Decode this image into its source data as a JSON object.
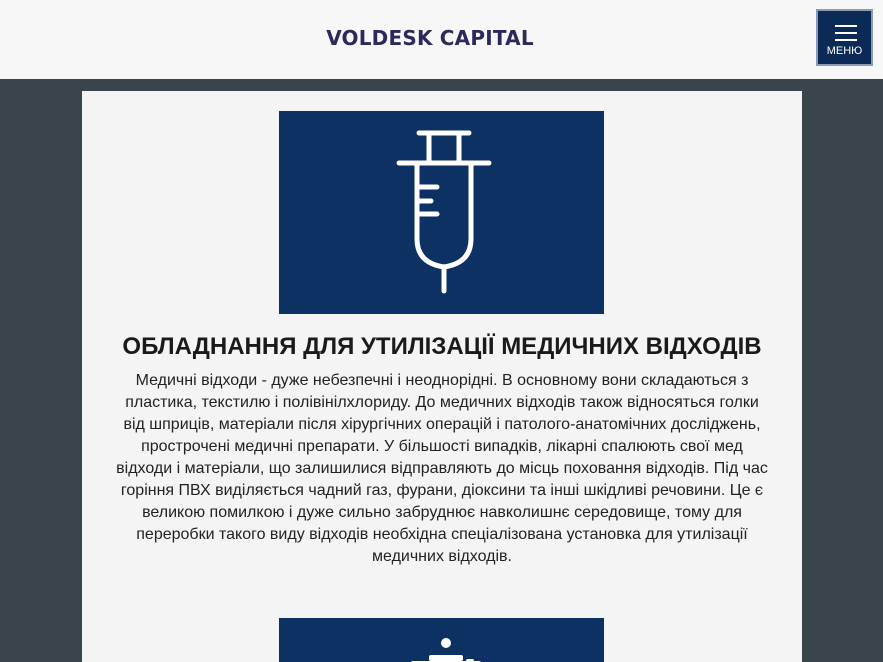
{
  "header": {
    "logo_text": "VOLDESK CAPITAL",
    "menu_label": "МЕНЮ"
  },
  "colors": {
    "header_bg": "#f7f7f7",
    "page_bg": "#3a444b",
    "brand_navy": "#0c3162",
    "logo_color": "#2a2a5c"
  },
  "card": {
    "icon": "syringe-icon",
    "title": "ОБЛАДНАННЯ ДЛЯ УТИЛІЗАЦІЇ МЕДИЧНИХ ВІДХОДІВ",
    "text_lines": [
      "Медичні відходи - дуже небезпечні і неоднорідні. В основному вони складаються з",
      "пластика, текстилю і полівінілхлориду. До медичних відходів також відносяться голки",
      "від шприців, матеріали після хірургічних операцій і патолого-анатомічних досліджень,",
      "прострочені медичні препарати. У більшості випадків, лікарні спалюють свої мед",
      "відходи і матеріали, що залишилися відправляють до місць поховання відходів. Під час",
      "горіння ПВХ виділяється чадний газ, фурани, діоксини та інші шкідливі речовини. Це є",
      "великою помилкою і дуже сильно забруднює навколишнє середовище, тому для",
      "переробки такого виду відходів необхідна спеціалізована установка для утилізації",
      "медичних відходів."
    ]
  },
  "next_card": {
    "icon": "equipment-icon"
  }
}
